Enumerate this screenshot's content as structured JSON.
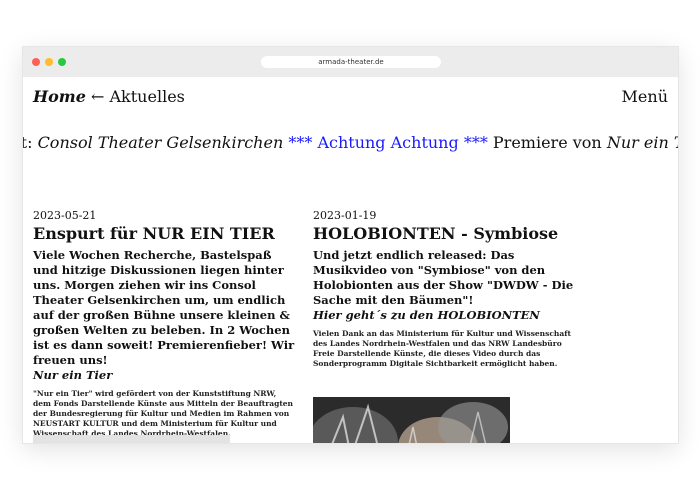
{
  "browser": {
    "url": "armada-theater.de"
  },
  "nav": {
    "home": "Home",
    "arrow": "←",
    "section": "Aktuelles",
    "menu": "Menü"
  },
  "ticker": {
    "part1": "rt: ",
    "part2": "Consol Theater Gelsenkirchen",
    "part3": " *** Achtung Achtung *** ",
    "part4": "Premiere von ",
    "part5": "Nur ein T"
  },
  "articles": [
    {
      "date": "2023-05-21",
      "title": "Enspurt für NUR EIN TIER",
      "lead": "Viele Wochen Recherche, Bastelspaß und hitzige Diskussionen liegen hinter uns. Morgen ziehen wir ins Consol Theater Gelsenkirchen um, um endlich auf der großen Bühne unsere kleinen & großen Welten zu beleben. In 2 Wochen ist es dann soweit! Premierenfieber! Wir freuen uns!",
      "lead_italic": "Nur ein Tier",
      "small": "\"Nur ein Tier\" wird gefördert von der Kunststiftung NRW, dem Fonds Darstellende Künste aus Mitteln der Beauftragten der Bundesregierung für Kultur und Medien im Rahmen von NEUSTART KULTUR und dem Ministerium für Kultur und Wissenschaft des Landes Nordrhein-Westfalen."
    },
    {
      "date": "2023-01-19",
      "title": "HOLOBIONTEN - Symbiose",
      "lead": "Und jetzt endlich released: Das Musikvideo von \"Symbiose\" von den Holobionten aus der Show \"DWDW - Die Sache mit den Bäumen\"!",
      "lead_italic": "Hier geht´s zu den HOLOBIONTEN",
      "small": "Vielen Dank an das Ministerium für Kultur und Wissenschaft des Landes Nordrhein-Westfalen und das NRW Landesbüro Freie Darstellende Künste, die dieses Video durch das Sonderprogramm Digitale Sichtbarkeit ermöglicht haben."
    }
  ]
}
